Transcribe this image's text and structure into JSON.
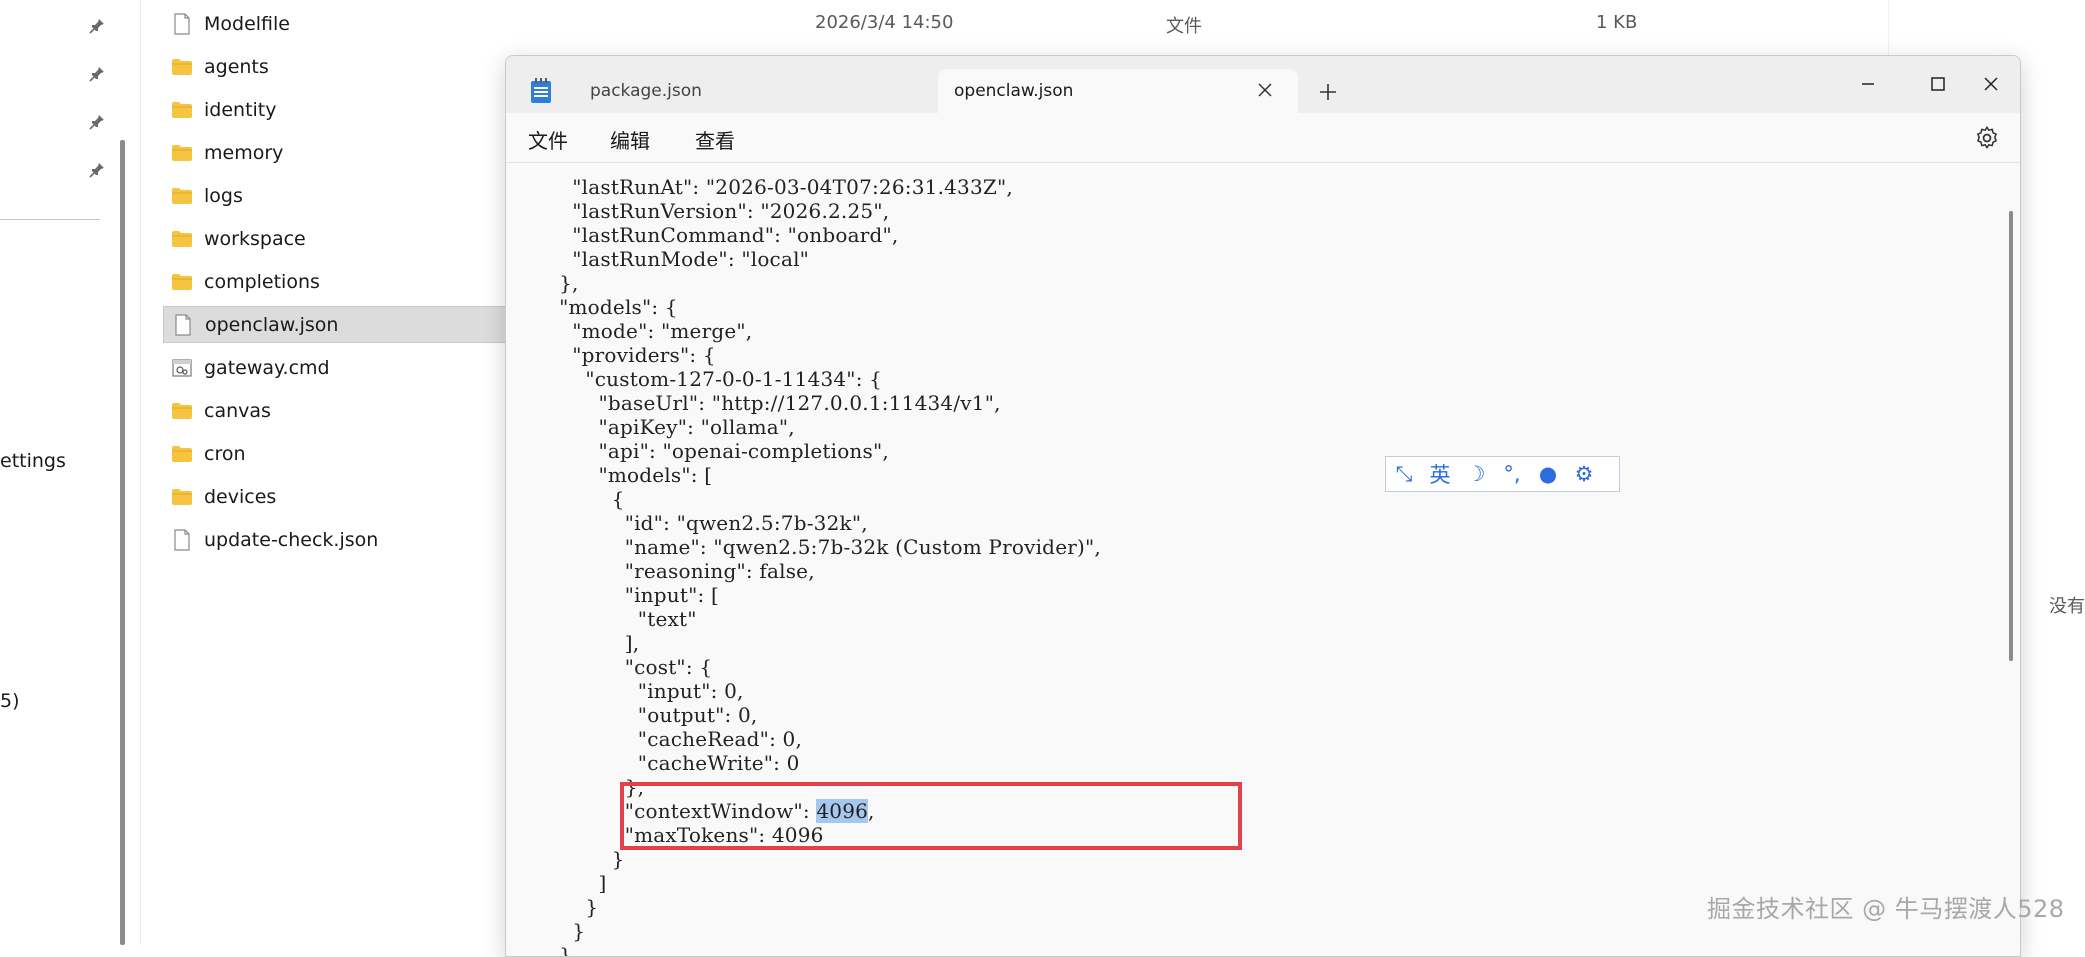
{
  "explorer": {
    "nav_texts": [
      "ettings",
      "5)"
    ],
    "files": [
      {
        "name": "Modelfile",
        "type": "file"
      },
      {
        "name": "agents",
        "type": "folder"
      },
      {
        "name": "identity",
        "type": "folder"
      },
      {
        "name": "memory",
        "type": "folder"
      },
      {
        "name": "logs",
        "type": "folder"
      },
      {
        "name": "workspace",
        "type": "folder"
      },
      {
        "name": "completions",
        "type": "folder"
      },
      {
        "name": "openclaw.json",
        "type": "file",
        "selected": true
      },
      {
        "name": "gateway.cmd",
        "type": "cmd"
      },
      {
        "name": "canvas",
        "type": "folder"
      },
      {
        "name": "cron",
        "type": "folder"
      },
      {
        "name": "devices",
        "type": "folder"
      },
      {
        "name": "update-check.json",
        "type": "file"
      }
    ],
    "top_row": {
      "date": "2026/3/4 14:50",
      "type": "文件",
      "size": "1 KB"
    },
    "side_text": "没有"
  },
  "notepad": {
    "tabs": [
      {
        "label": "package.json",
        "active": false
      },
      {
        "label": "openclaw.json",
        "active": true
      }
    ],
    "menus": [
      "文件",
      "编辑",
      "查看"
    ],
    "code_lines": [
      "    \"lastRunAt\": \"2026-03-04T07:26:31.433Z\",",
      "    \"lastRunVersion\": \"2026.2.25\",",
      "    \"lastRunCommand\": \"onboard\",",
      "    \"lastRunMode\": \"local\"",
      "  },",
      "  \"models\": {",
      "    \"mode\": \"merge\",",
      "    \"providers\": {",
      "      \"custom-127-0-0-1-11434\": {",
      "        \"baseUrl\": \"http://127.0.0.1:11434/v1\",",
      "        \"apiKey\": \"ollama\",",
      "        \"api\": \"openai-completions\",",
      "        \"models\": [",
      "          {",
      "            \"id\": \"qwen2.5:7b-32k\",",
      "            \"name\": \"qwen2.5:7b-32k (Custom Provider)\",",
      "            \"reasoning\": false,",
      "            \"input\": [",
      "              \"text\"",
      "            ],",
      "            \"cost\": {",
      "              \"input\": 0,",
      "              \"output\": 0,",
      "              \"cacheRead\": 0,",
      "              \"cacheWrite\": 0",
      "            },",
      "            \"contextWindow\": 4096,",
      "            \"maxTokens\": 4096",
      "          }",
      "        ]",
      "      }",
      "    }",
      "  }"
    ],
    "highlight": {
      "line_index": 26,
      "text": "4096"
    }
  },
  "ime": {
    "items": [
      {
        "icon": "expand-icon",
        "text": "⤡"
      },
      {
        "icon": "chinese-mode-icon",
        "text": "英"
      },
      {
        "icon": "moon-icon",
        "text": "☽"
      },
      {
        "icon": "punctuation-icon",
        "text": "°,"
      },
      {
        "icon": "user-icon",
        "text": "●"
      },
      {
        "icon": "gear-icon",
        "text": "⚙"
      }
    ]
  },
  "watermark": "掘金技术社区 @ 牛马摆渡人528",
  "colors": {
    "folder": "#f5c440",
    "highlight_box": "#e0424d",
    "selection": "#a7c8ee",
    "ime": "#2d6be0"
  }
}
